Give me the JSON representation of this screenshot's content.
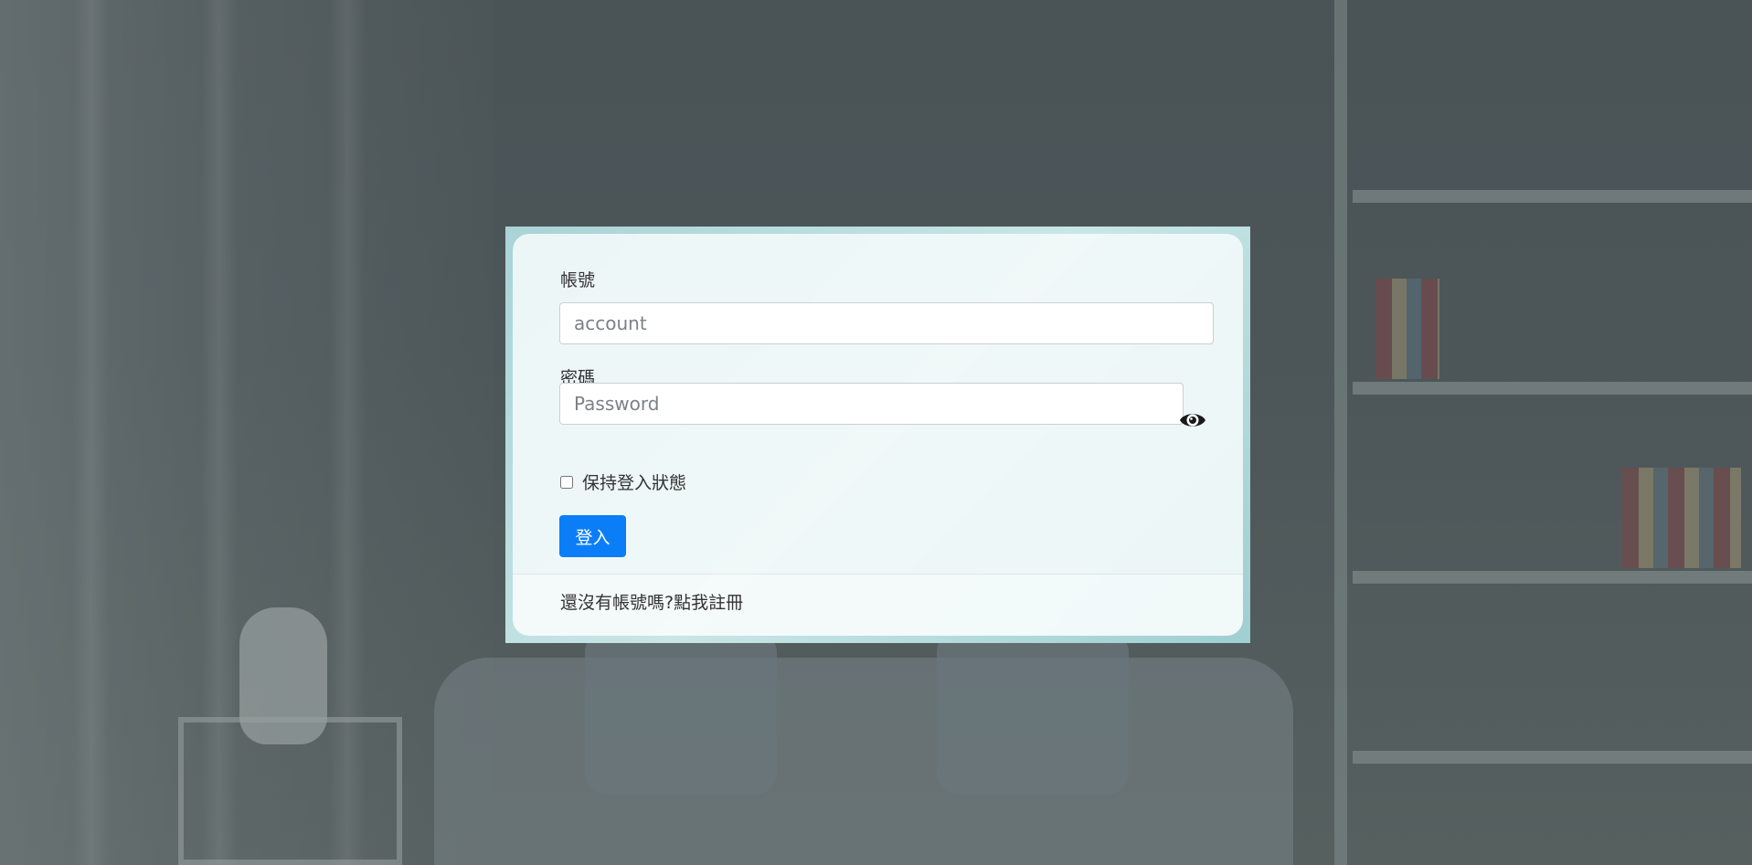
{
  "login": {
    "account_label": "帳號",
    "account_placeholder": "account",
    "password_label": "密碼",
    "password_placeholder": "Password",
    "remember_label": "保持登入狀態",
    "remember_checked": false,
    "login_button": "登入",
    "register_text": "還沒有帳號嗎?點我註冊"
  },
  "colors": {
    "primary_button": "#0b7ef7",
    "overlay": "#4a5356"
  }
}
